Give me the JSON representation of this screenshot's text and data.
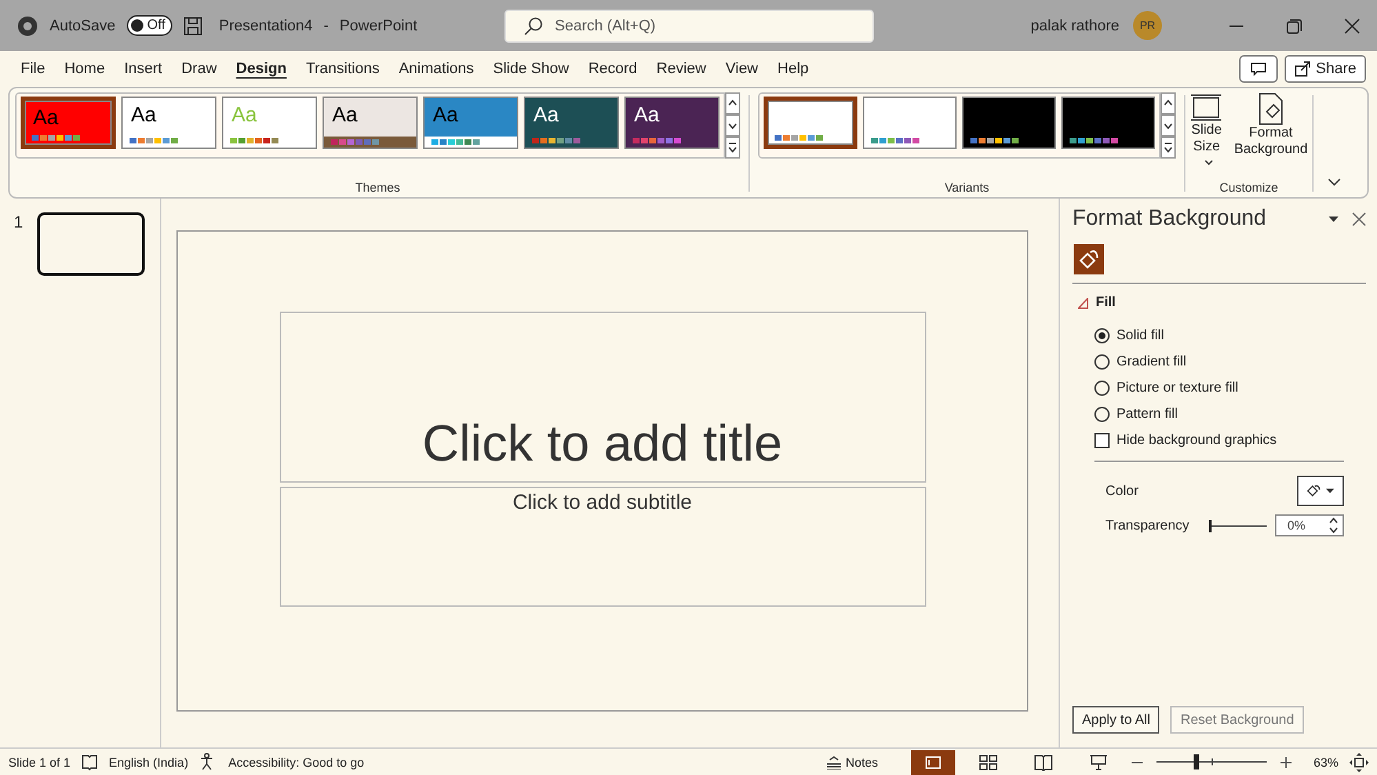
{
  "title_bar": {
    "autosave_label": "AutoSave",
    "autosave_toggle": {
      "on": false,
      "label": "Off"
    },
    "document": "Presentation4",
    "separator": "-",
    "app": "PowerPoint",
    "search": {
      "placeholder": "Search (Alt+Q)"
    },
    "user": "palak rathore",
    "initials": "PR"
  },
  "ribbon_tabs": [
    {
      "label": "File",
      "selected": false
    },
    {
      "label": "Home",
      "selected": false
    },
    {
      "label": "Insert",
      "selected": false
    },
    {
      "label": "Draw",
      "selected": false
    },
    {
      "label": "Design",
      "selected": true
    },
    {
      "label": "Transitions",
      "selected": false
    },
    {
      "label": "Animations",
      "selected": false
    },
    {
      "label": "Slide Show",
      "selected": false
    },
    {
      "label": "Record",
      "selected": false
    },
    {
      "label": "Review",
      "selected": false
    },
    {
      "label": "View",
      "selected": false
    },
    {
      "label": "Help",
      "selected": false
    }
  ],
  "share_button": "Share",
  "themes": {
    "label": "Themes",
    "items": [
      {
        "sample": {
          "text": "Aa",
          "color": "#000000"
        },
        "selected": true,
        "color": "#ff0000",
        "swatches": [
          {
            "color": "#4472c4"
          },
          {
            "color": "#ed7d31"
          },
          {
            "color": "#a5a5a5"
          },
          {
            "color": "#ffc000"
          },
          {
            "color": "#5b9bd5"
          },
          {
            "color": "#70ad47"
          }
        ]
      },
      {
        "sample": {
          "text": "Aa",
          "color": "#000000"
        },
        "selected": false,
        "color": "#ffffff",
        "swatches": [
          {
            "color": "#4472c4"
          },
          {
            "color": "#ed7d31"
          },
          {
            "color": "#a5a5a5"
          },
          {
            "color": "#ffc000"
          },
          {
            "color": "#5b9bd5"
          },
          {
            "color": "#70ad47"
          }
        ]
      },
      {
        "sample": {
          "text": "Aa",
          "color": "#8ac43f"
        },
        "selected": false,
        "color": "#ffffff",
        "swatches": [
          {
            "color": "#8ac43f"
          },
          {
            "color": "#55a031"
          },
          {
            "color": "#e0b22c"
          },
          {
            "color": "#e4631e"
          },
          {
            "color": "#c8241d"
          },
          {
            "color": "#948a54"
          }
        ]
      },
      {
        "sample": {
          "text": "Aa",
          "color": "#000000"
        },
        "selected": false,
        "color": "#ece6e2",
        "footer": {
          "color": "#7a5a3a"
        },
        "swatches": [
          {
            "color": "#c0245d"
          },
          {
            "color": "#d84a8c"
          },
          {
            "color": "#b565d4"
          },
          {
            "color": "#7c5bb8"
          },
          {
            "color": "#5f6dbb"
          },
          {
            "color": "#6f96a6"
          }
        ]
      },
      {
        "sample": {
          "text": "Aa",
          "color": "#000000"
        },
        "selected": false,
        "color": "#2a87c4",
        "footer": {
          "color": "#ffffff"
        },
        "swatches": [
          {
            "color": "#1cade4"
          },
          {
            "color": "#2683c6"
          },
          {
            "color": "#27ced7"
          },
          {
            "color": "#42ba97"
          },
          {
            "color": "#3e8853"
          },
          {
            "color": "#62a39f"
          }
        ]
      },
      {
        "sample": {
          "text": "Aa",
          "color": "#ffffff"
        },
        "selected": false,
        "color": "#1d4f55",
        "swatches": [
          {
            "color": "#c0261a"
          },
          {
            "color": "#e46d1e"
          },
          {
            "color": "#e9b52f"
          },
          {
            "color": "#70a084"
          },
          {
            "color": "#5f8ca5"
          },
          {
            "color": "#9d5b9c"
          }
        ]
      },
      {
        "sample": {
          "text": "Aa",
          "color": "#ffffff"
        },
        "selected": false,
        "color": "#4b2454",
        "swatches": [
          {
            "color": "#c42b5e"
          },
          {
            "color": "#e1436c"
          },
          {
            "color": "#e8663a"
          },
          {
            "color": "#a05cc9"
          },
          {
            "color": "#8d71e2"
          },
          {
            "color": "#d74bd2"
          }
        ]
      }
    ]
  },
  "variants": {
    "label": "Variants",
    "items": [
      {
        "selected": true,
        "color": "#ffffff",
        "swatches": [
          {
            "color": "#4472c4"
          },
          {
            "color": "#ed7d31"
          },
          {
            "color": "#a5a5a5"
          },
          {
            "color": "#ffc000"
          },
          {
            "color": "#5b9bd5"
          },
          {
            "color": "#70ad47"
          }
        ]
      },
      {
        "selected": false,
        "color": "#ffffff",
        "swatches": [
          {
            "color": "#3a9c8c"
          },
          {
            "color": "#2f9fd0"
          },
          {
            "color": "#7cbf4a"
          },
          {
            "color": "#5a70c4"
          },
          {
            "color": "#8e59b8"
          },
          {
            "color": "#d24aa4"
          }
        ]
      },
      {
        "selected": false,
        "color": "#000000",
        "swatches": [
          {
            "color": "#4472c4"
          },
          {
            "color": "#ed7d31"
          },
          {
            "color": "#a5a5a5"
          },
          {
            "color": "#ffc000"
          },
          {
            "color": "#5b9bd5"
          },
          {
            "color": "#70ad47"
          }
        ]
      },
      {
        "selected": false,
        "color": "#000000",
        "swatches": [
          {
            "color": "#3a9c8c"
          },
          {
            "color": "#2f9fd0"
          },
          {
            "color": "#7cbf4a"
          },
          {
            "color": "#5a70c4"
          },
          {
            "color": "#8e59b8"
          },
          {
            "color": "#d24aa4"
          }
        ]
      }
    ]
  },
  "customize": {
    "label": "Customize",
    "slide_size": [
      "Slide",
      "Size"
    ],
    "format_background": [
      "Format",
      "Background"
    ]
  },
  "slide_pane": {
    "number": "1"
  },
  "slide": {
    "title_placeholder": "Click to add title",
    "subtitle_placeholder": "Click to add subtitle"
  },
  "format_panel": {
    "title": "Format Background",
    "section": "Fill",
    "options": [
      {
        "label": "Solid fill",
        "selected": true
      },
      {
        "label": "Gradient fill",
        "selected": false
      },
      {
        "label": "Picture or texture fill",
        "selected": false
      },
      {
        "label": "Pattern fill",
        "selected": false
      }
    ],
    "hide_graphics": {
      "label": "Hide background graphics",
      "checked": false
    },
    "color_label": "Color",
    "transparency": {
      "label": "Transparency",
      "level": 0,
      "reading": "0%"
    },
    "buttons": [
      {
        "label": "Apply to All",
        "disabled": false
      },
      {
        "label": "Reset Background",
        "disabled": true
      }
    ]
  },
  "status_bar": {
    "slide_count": "Slide 1 of 1",
    "language": "English (India)",
    "accessibility": "Accessibility: Good to go",
    "notes": "Notes",
    "views": [
      {
        "kind": "normal",
        "selected": true
      },
      {
        "kind": "sorter",
        "selected": false
      },
      {
        "kind": "reading",
        "selected": false
      },
      {
        "kind": "show",
        "selected": false
      }
    ],
    "zoom": {
      "level": 0.34,
      "reading": "63%"
    }
  }
}
